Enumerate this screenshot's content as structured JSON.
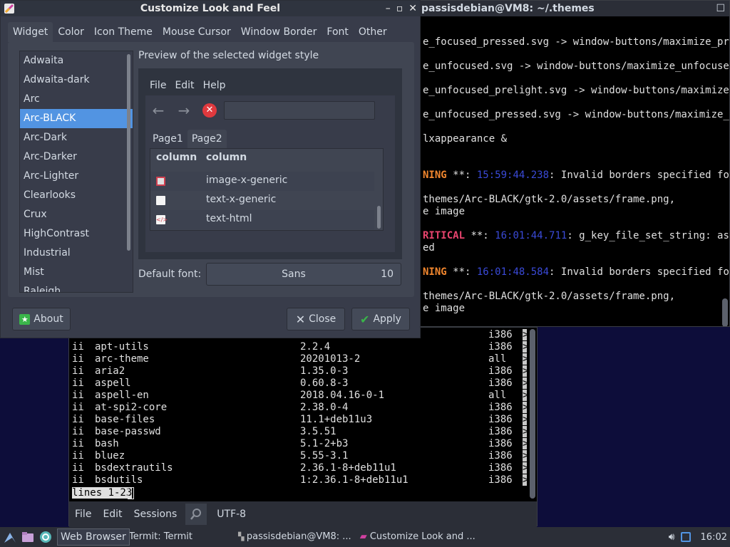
{
  "right_terminal": {
    "title": "passisdebian@VM8: ~/.themes",
    "lines": [
      {
        "t": "e_focused_pressed.svg -> window-buttons/maximize_pres"
      },
      {
        "t": "e_unfocused.svg -> window-buttons/maximize_unfocused."
      },
      {
        "t": "e_unfocused_prelight.svg -> window-buttons/maximize_p"
      },
      {
        "t": "e_unfocused_pressed.svg -> window-buttons/maximize_pr"
      },
      {
        "t": "lxappearance &"
      },
      {
        "t1": "NING",
        "t2": " **: ",
        "t3": "15:59:44.238",
        "t4": ": Invalid borders specified for"
      },
      {
        "t": "themes/Arc-BLACK/gtk-2.0/assets/frame.png,"
      },
      {
        "t": "e image"
      },
      {
        "t1": "RITICAL",
        "t2": " **: ",
        "t3": "16:01:44.711",
        "t4": ": g_key_file_set_string: asse"
      },
      {
        "t": "ed"
      },
      {
        "t1": "NING",
        "t2": " **: ",
        "t3": "16:01:48.584",
        "t4": ": Invalid borders specified for"
      },
      {
        "t": "themes/Arc-BLACK/gtk-2.0/assets/frame.png,"
      },
      {
        "t": "e image"
      }
    ]
  },
  "bottom_terminal": {
    "packages": [
      {
        "s": "",
        "name": "",
        "ver": "",
        "arch": "i386"
      },
      {
        "s": "ii",
        "name": "apt-utils",
        "ver": "2.2.4",
        "arch": "i386"
      },
      {
        "s": "ii",
        "name": "arc-theme",
        "ver": "20201013-2",
        "arch": "all"
      },
      {
        "s": "ii",
        "name": "aria2",
        "ver": "1.35.0-3",
        "arch": "i386"
      },
      {
        "s": "ii",
        "name": "aspell",
        "ver": "0.60.8-3",
        "arch": "i386"
      },
      {
        "s": "ii",
        "name": "aspell-en",
        "ver": "2018.04.16-0-1",
        "arch": "all"
      },
      {
        "s": "ii",
        "name": "at-spi2-core",
        "ver": "2.38.0-4",
        "arch": "i386"
      },
      {
        "s": "ii",
        "name": "base-files",
        "ver": "11.1+deb11u3",
        "arch": "i386"
      },
      {
        "s": "ii",
        "name": "base-passwd",
        "ver": "3.5.51",
        "arch": "i386"
      },
      {
        "s": "ii",
        "name": "bash",
        "ver": "5.1-2+b3",
        "arch": "i386"
      },
      {
        "s": "ii",
        "name": "bluez",
        "ver": "5.55-3.1",
        "arch": "i386"
      },
      {
        "s": "ii",
        "name": "bsdextrautils",
        "ver": "2.36.1-8+deb11u1",
        "arch": "i386"
      },
      {
        "s": "ii",
        "name": "bsdutils",
        "ver": "1:2.36.1-8+deb11u1",
        "arch": "i386"
      }
    ],
    "overflow_marker": ">",
    "status": "lines 1-23",
    "menu": {
      "file": "File",
      "edit": "Edit",
      "sessions": "Sessions",
      "encoding": "UTF-8"
    }
  },
  "dialog": {
    "title": "Customize Look and Feel",
    "tabs": [
      "Widget",
      "Color",
      "Icon Theme",
      "Mouse Cursor",
      "Window Border",
      "Font",
      "Other"
    ],
    "active_tab": "Widget",
    "themes": [
      "Adwaita",
      "Adwaita-dark",
      "Arc",
      "Arc-BLACK",
      "Arc-Dark",
      "Arc-Darker",
      "Arc-Lighter",
      "Clearlooks",
      "Crux",
      "HighContrast",
      "Industrial",
      "Mist",
      "Raleigh"
    ],
    "selected_theme": "Arc-BLACK",
    "preview": {
      "label": "Preview of the selected widget style",
      "menu": [
        "File",
        "Edit",
        "Help"
      ],
      "tabs": [
        "Page1",
        "Page2"
      ],
      "active_tab": "Page2",
      "columns": [
        "column",
        "column"
      ],
      "rows": [
        {
          "icon": "image-icon",
          "text": "image-x-generic"
        },
        {
          "icon": "text-file-icon",
          "text": "text-x-generic"
        },
        {
          "icon": "html-file-icon",
          "text": "text-html"
        }
      ]
    },
    "font": {
      "label": "Default font:",
      "name": "Sans",
      "size": "10"
    },
    "buttons": {
      "about": "About",
      "close": "Close",
      "apply": "Apply"
    }
  },
  "taskbar": {
    "tooltip": "Web Browser",
    "tasks": [
      "Termit: Termit",
      "passisdebian@VM8: ...",
      "Customize Look and ..."
    ],
    "clock": "16:02"
  }
}
